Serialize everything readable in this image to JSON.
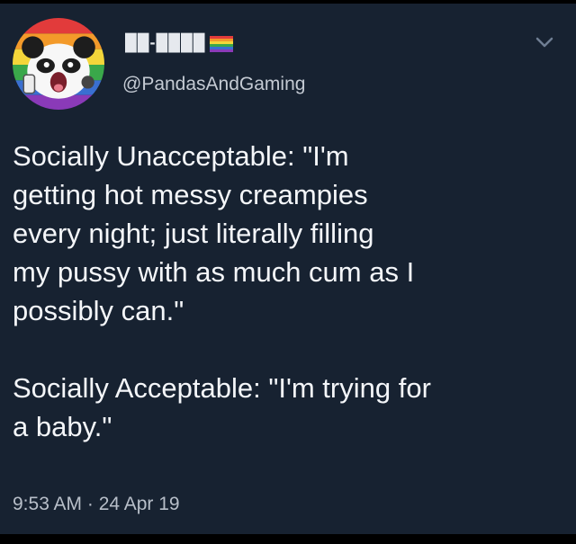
{
  "tweet": {
    "display_name": "██-████",
    "handle": "@PandasAndGaming",
    "avatar_icon": "panda-avatar-icon",
    "flag_icon": "pride-flag-icon",
    "menu_icon": "chevron-down-icon",
    "paragraphs": [
      "Socially Unacceptable: \"I'm\ngetting hot messy creampies\nevery night; just literally filling\nmy pussy with as much cum as I\npossibly can.\"",
      "Socially Acceptable: \"I'm trying for\na baby.\""
    ],
    "timestamp": "9:53 AM · 24 Apr 19"
  },
  "colors": {
    "background": "#172231",
    "text": "#f2f4f7",
    "secondary_text": "#b8bfc9",
    "chevron": "#6f7e93"
  }
}
